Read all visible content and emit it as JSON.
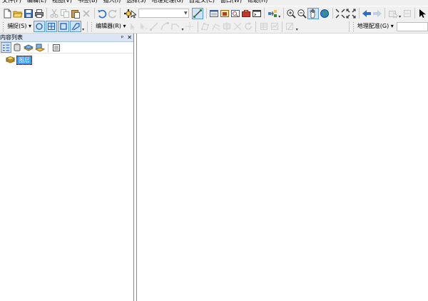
{
  "menu": [
    "文件(F)",
    "编辑(E)",
    "视图(V)",
    "书签(B)",
    "插入(I)",
    "选择(S)",
    "地理处理(G)",
    "自定义(C)",
    "窗口(W)",
    "帮助(H)"
  ],
  "toolbar2": {
    "snapping_label": "捕捉(S)",
    "editor_label": "编辑器(R)",
    "georef_label": "地理配准(G)"
  },
  "toc": {
    "title": "内容列表",
    "pin_glyph": "ᵖ",
    "close_glyph": "✕",
    "layer_label": "图层"
  },
  "colors": {
    "accent": "#3399ff",
    "panel_title_bg": "#dbe6f4",
    "toolbar_bg": "#f0f0f0"
  }
}
